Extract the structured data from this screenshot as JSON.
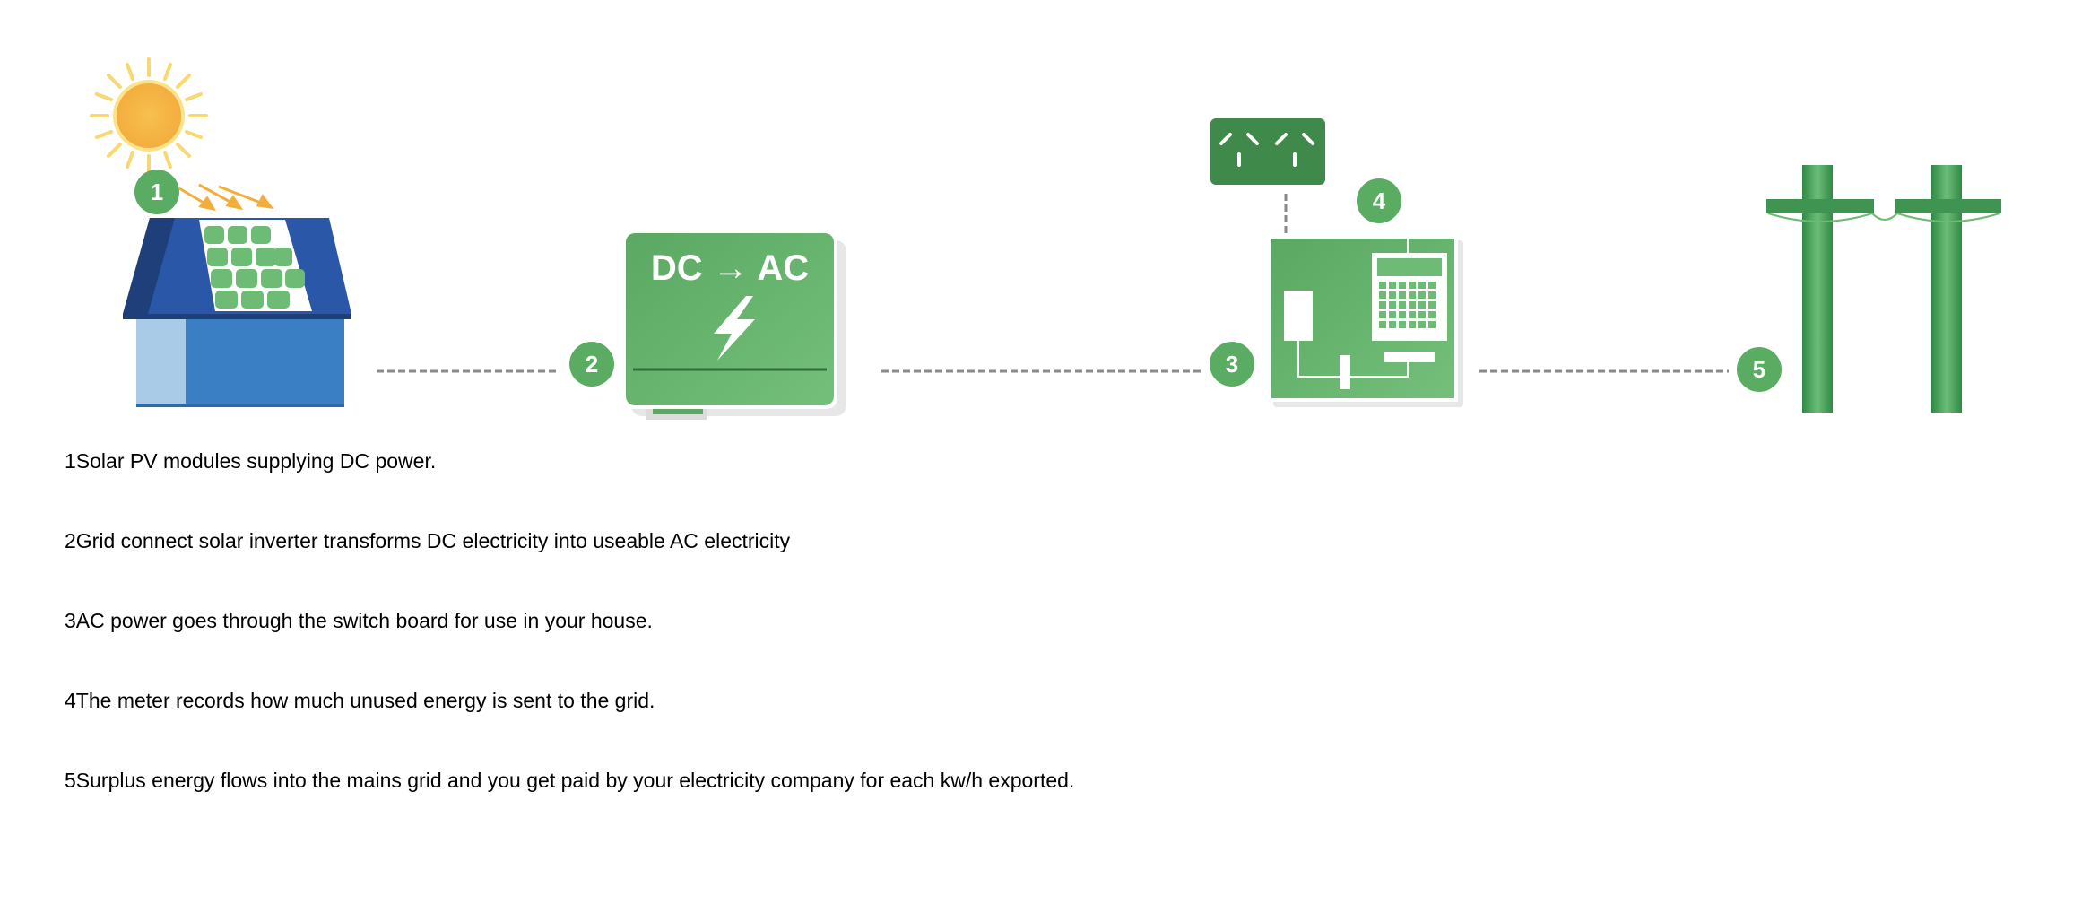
{
  "diagram": {
    "inverter_label": "DC → AC",
    "accent_green": "#6dbb74",
    "dark_green": "#4a9a55",
    "roof_blue": "#2a57a8",
    "wall_blue": "#3a7fc4",
    "sun_orange": "#f5b94a"
  },
  "badges": {
    "b1": "1",
    "b2": "2",
    "b3": "3",
    "b4": "4",
    "b5": "5"
  },
  "steps": [
    {
      "num": "1",
      "text": "Solar PV modules supplying DC power."
    },
    {
      "num": "2",
      "text": "Grid connect solar inverter transforms DC electricity into useable AC electricity"
    },
    {
      "num": "3",
      "text": "AC power goes through the switch board for use in your house."
    },
    {
      "num": "4",
      "text": "The meter records how much unused energy is sent to the grid."
    },
    {
      "num": "5",
      "text": "Surplus energy flows into the mains grid and you get paid by your electricity company for each kw/h exported."
    }
  ]
}
